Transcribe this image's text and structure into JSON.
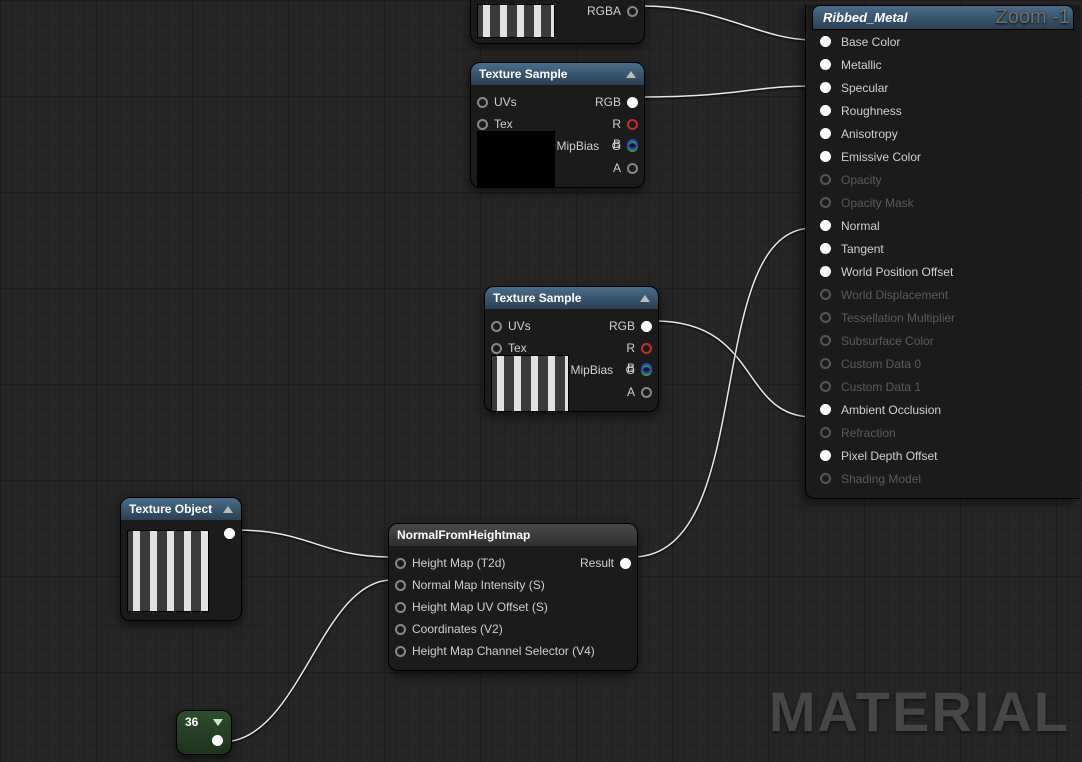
{
  "zoom_label": "Zoom -1",
  "watermark": "MATERIAL",
  "texture_sample_title": "Texture Sample",
  "texture_object_title": "Texture Object",
  "normal_hm_title": "NormalFromHeightmap",
  "pins": {
    "uvs": "UVs",
    "tex": "Tex",
    "mip": "Apply View MipBias",
    "rgb": "RGB",
    "r": "R",
    "g": "G",
    "b": "B",
    "a": "A",
    "rgba": "RGBA"
  },
  "normal_hm": {
    "hm": "Height Map (T2d)",
    "intensity": "Normal Map Intensity (S)",
    "uvoff": "Height Map UV Offset (S)",
    "coords": "Coordinates (V2)",
    "chansel": "Height Map Channel Selector (V4)",
    "result": "Result"
  },
  "constant_value": "36",
  "result": {
    "title": "Ribbed_Metal",
    "inputs": [
      {
        "label": "Base Color",
        "active": true
      },
      {
        "label": "Metallic",
        "active": true
      },
      {
        "label": "Specular",
        "active": true
      },
      {
        "label": "Roughness",
        "active": true
      },
      {
        "label": "Anisotropy",
        "active": true
      },
      {
        "label": "Emissive Color",
        "active": true
      },
      {
        "label": "Opacity",
        "active": false
      },
      {
        "label": "Opacity Mask",
        "active": false
      },
      {
        "label": "Normal",
        "active": true
      },
      {
        "label": "Tangent",
        "active": true
      },
      {
        "label": "World Position Offset",
        "active": true
      },
      {
        "label": "World Displacement",
        "active": false
      },
      {
        "label": "Tessellation Multiplier",
        "active": false
      },
      {
        "label": "Subsurface Color",
        "active": false
      },
      {
        "label": "Custom Data 0",
        "active": false
      },
      {
        "label": "Custom Data 1",
        "active": false
      },
      {
        "label": "Ambient Occlusion",
        "active": true
      },
      {
        "label": "Refraction",
        "active": false
      },
      {
        "label": "Pixel Depth Offset",
        "active": true
      },
      {
        "label": "Shading Model",
        "active": false
      }
    ]
  }
}
